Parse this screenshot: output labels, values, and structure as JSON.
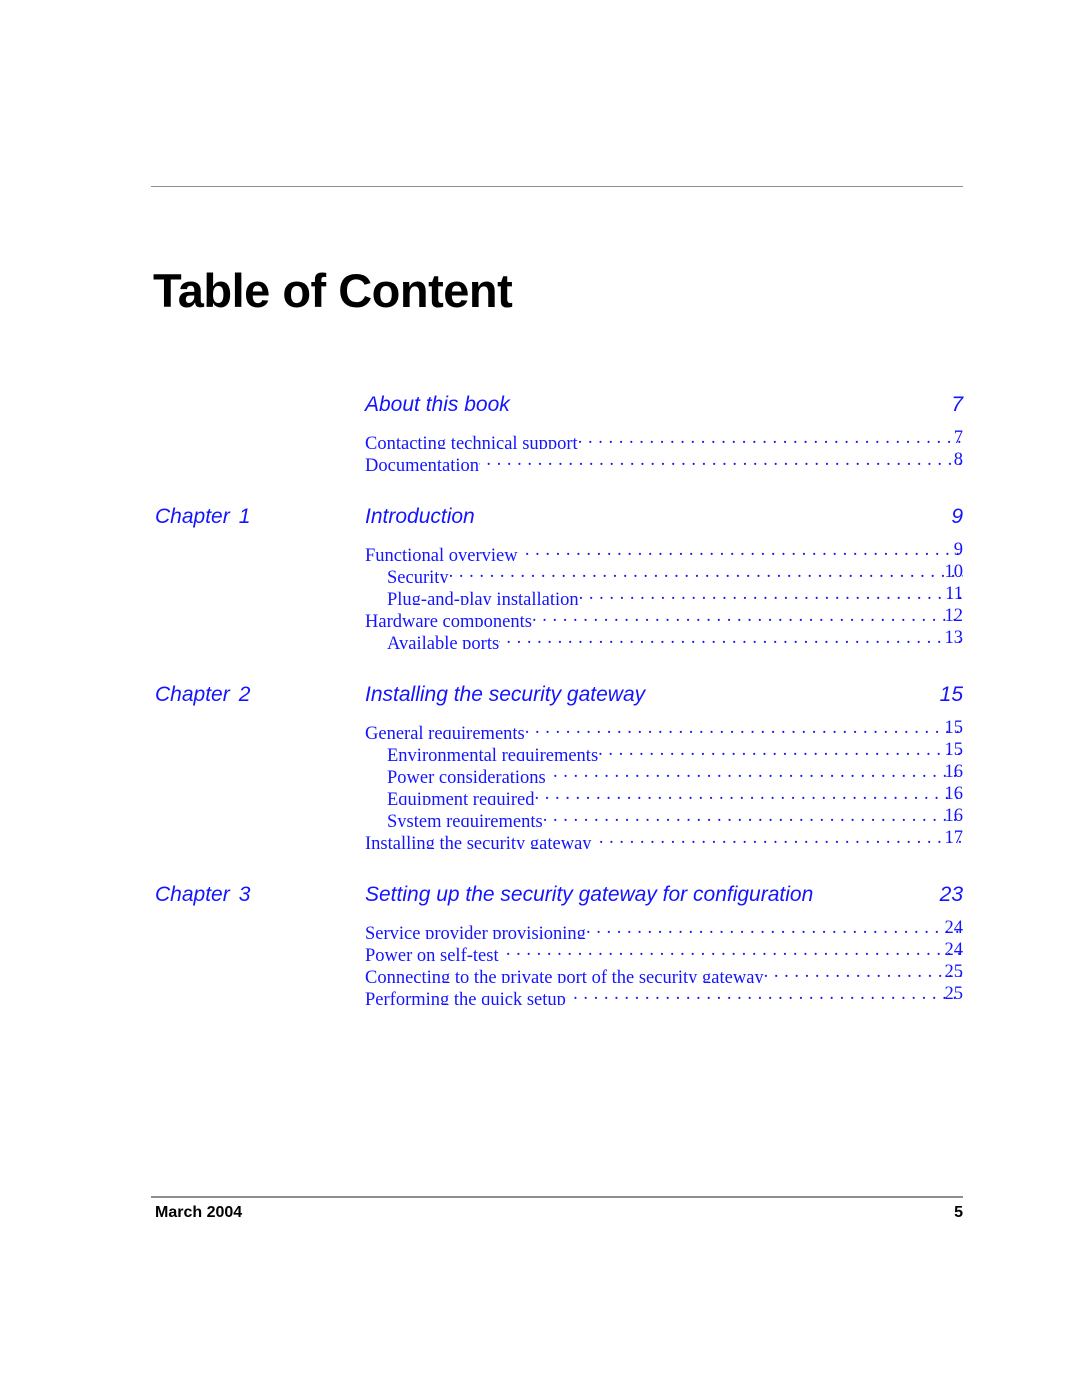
{
  "document": {
    "title": "Table of Content"
  },
  "footer": {
    "date": "March 2004",
    "page_number": "5"
  },
  "toc": {
    "sections": [
      {
        "chapter_word": "",
        "chapter_number": "",
        "title": "About this book",
        "page": "7",
        "entries": [
          {
            "text": "Contacting technical support",
            "page": "7",
            "level": 1,
            "tight": false
          },
          {
            "text": "Documentation",
            "page": "8",
            "level": 1,
            "tight": true
          }
        ]
      },
      {
        "chapter_word": "Chapter",
        "chapter_number": "1",
        "title": "Introduction",
        "page": "9",
        "entries": [
          {
            "text": "Functional overview",
            "page": "9",
            "level": 1,
            "tight": true
          },
          {
            "text": "Security",
            "page": "10",
            "level": 2,
            "tight": false
          },
          {
            "text": "Plug-and-play installation",
            "page": "11",
            "level": 2,
            "tight": false
          },
          {
            "text": "Hardware components",
            "page": "12",
            "level": 1,
            "tight": false
          },
          {
            "text": "Available ports",
            "page": "13",
            "level": 2,
            "tight": true
          }
        ]
      },
      {
        "chapter_word": "Chapter",
        "chapter_number": "2",
        "title": "Installing the security gateway",
        "page": "15",
        "entries": [
          {
            "text": "General requirements",
            "page": "15",
            "level": 1,
            "tight": false
          },
          {
            "text": "Environmental requirements",
            "page": "15",
            "level": 2,
            "tight": false
          },
          {
            "text": "Power considerations",
            "page": "16",
            "level": 2,
            "tight": true
          },
          {
            "text": "Equipment required",
            "page": "16",
            "level": 2,
            "tight": false
          },
          {
            "text": "System requirements",
            "page": "16",
            "level": 2,
            "tight": false
          },
          {
            "text": "Installing the security gateway",
            "page": "17",
            "level": 1,
            "tight": true
          }
        ]
      },
      {
        "chapter_word": "Chapter",
        "chapter_number": "3",
        "title": "Setting up the security gateway for configuration",
        "page": "23",
        "entries": [
          {
            "text": "Service provider provisioning",
            "page": "24",
            "level": 1,
            "tight": false
          },
          {
            "text": "Power on self-test",
            "page": "24",
            "level": 1,
            "tight": true
          },
          {
            "text": "Connecting to the private port of the security gateway",
            "page": "25",
            "level": 1,
            "tight": false
          },
          {
            "text": "Performing the quick setup",
            "page": "25",
            "level": 1,
            "tight": true
          }
        ]
      }
    ]
  },
  "colors": {
    "link_blue": "#1414ff",
    "rule_gray": "#8d8d8d",
    "text_black": "#000000"
  }
}
